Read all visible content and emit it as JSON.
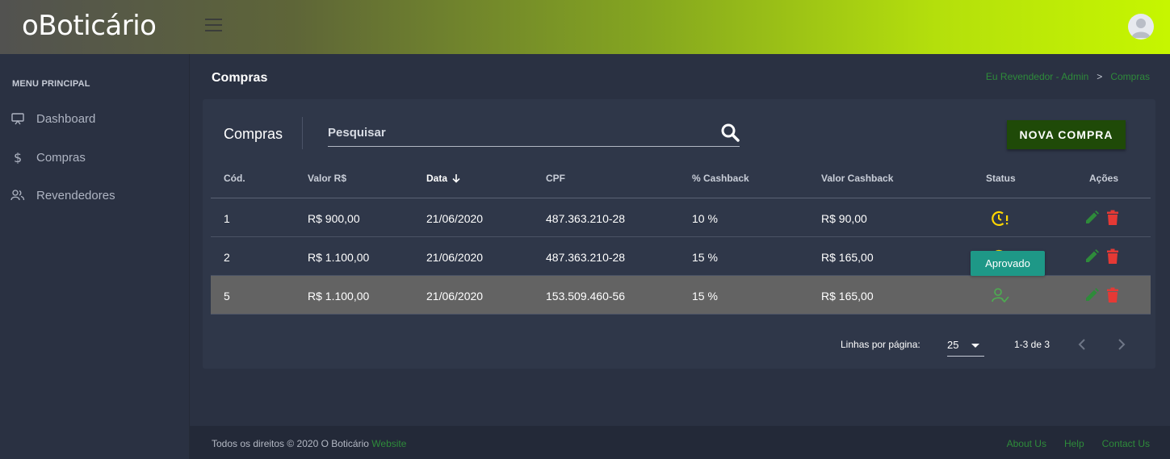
{
  "header": {
    "logo": "oBoticário"
  },
  "sidebar": {
    "section_title": "MENU PRINCIPAL",
    "items": [
      {
        "label": "Dashboard",
        "icon": "monitor-icon"
      },
      {
        "label": "Compras",
        "icon": "dollar-icon"
      },
      {
        "label": "Revendedores",
        "icon": "users-icon"
      }
    ]
  },
  "page": {
    "title": "Compras",
    "breadcrumb": {
      "root": "Eu Revendedor - Admin",
      "separator": ">",
      "current": "Compras"
    }
  },
  "card": {
    "title": "Compras",
    "search_placeholder": "Pesquisar",
    "new_button": "NOVA COMPRA"
  },
  "table": {
    "columns": {
      "cod": "Cód.",
      "valor": "Valor R$",
      "data": "Data",
      "cpf": "CPF",
      "pct": "% Cashback",
      "vcash": "Valor Cashback",
      "status": "Status",
      "acoes": "Ações"
    },
    "rows": [
      {
        "cod": "1",
        "valor": "R$ 900,00",
        "data": "21/06/2020",
        "cpf": "487.363.210-28",
        "pct": "10 %",
        "vcash": "R$ 90,00",
        "status": "pending"
      },
      {
        "cod": "2",
        "valor": "R$ 1.100,00",
        "data": "21/06/2020",
        "cpf": "487.363.210-28",
        "pct": "15 %",
        "vcash": "R$ 165,00",
        "status": "pending"
      },
      {
        "cod": "5",
        "valor": "R$ 1.100,00",
        "data": "21/06/2020",
        "cpf": "153.509.460-56",
        "pct": "15 %",
        "vcash": "R$ 165,00",
        "status": "approved"
      }
    ],
    "tooltip": "Aprovado",
    "pagination": {
      "rows_label": "Linhas por página:",
      "rows_value": "25",
      "range": "1-3 de 3"
    }
  },
  "footer": {
    "copyright": "Todos os direitos © 2020 O Boticário",
    "website_link": "Website",
    "links": [
      "About Us",
      "Help",
      "Contact Us"
    ]
  },
  "colors": {
    "accent_green": "#2e8b3a",
    "button_dark_green": "#1f4a08",
    "pending_yellow": "#ffd600",
    "approved_green": "#4caf50",
    "delete_red": "#e53935",
    "tooltip_teal": "#1e9887"
  }
}
